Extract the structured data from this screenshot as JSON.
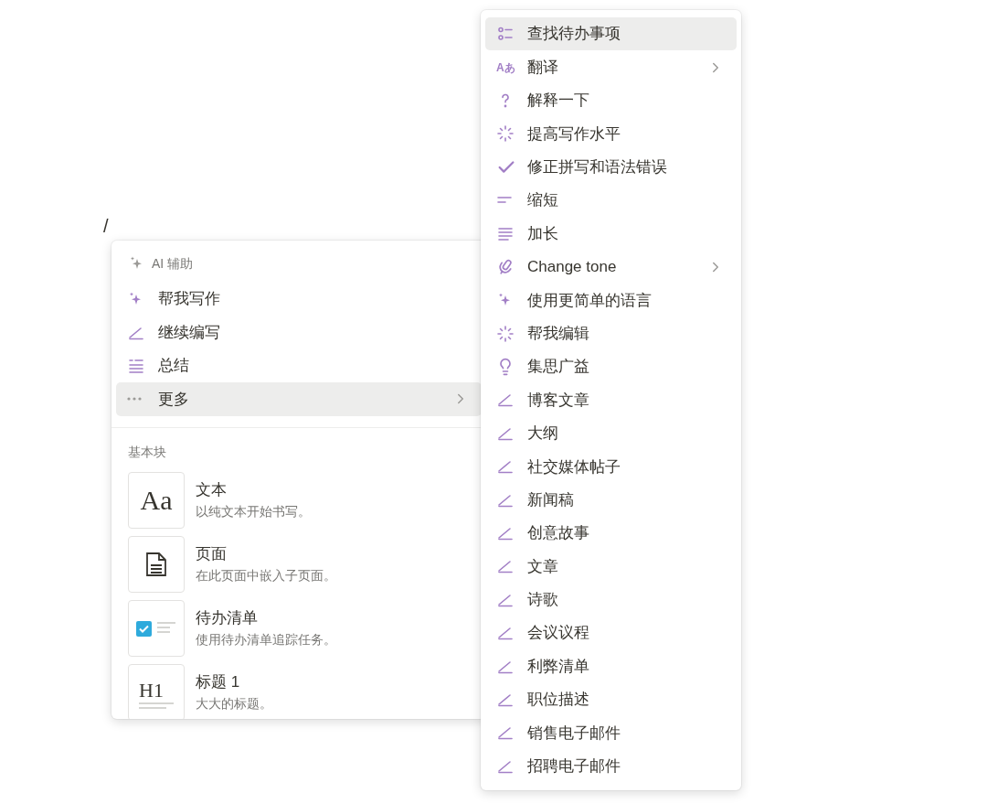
{
  "editor": {
    "slash": "/"
  },
  "block_menu": {
    "ai_section": {
      "title": "AI 辅助",
      "items": [
        {
          "kind": "sparkle",
          "label": "帮我写作",
          "selected": false,
          "submenu": false
        },
        {
          "kind": "pen",
          "label": "继续编写",
          "selected": false,
          "submenu": false
        },
        {
          "kind": "summary",
          "label": "总结",
          "selected": false,
          "submenu": false
        },
        {
          "kind": "dots",
          "label": "更多",
          "selected": true,
          "submenu": true
        }
      ]
    },
    "basic_section": {
      "title": "基本块",
      "items": [
        {
          "kind": "text",
          "icon_text": "Aa",
          "title": "文本",
          "description": "以纯文本开始书写。"
        },
        {
          "kind": "page",
          "title": "页面",
          "description": "在此页面中嵌入子页面。"
        },
        {
          "kind": "todo",
          "title": "待办清单",
          "description": "使用待办清单追踪任务。"
        },
        {
          "kind": "heading",
          "icon_text": "H1",
          "title": "标题 1",
          "description": "大大的标题。"
        }
      ]
    }
  },
  "submenu": {
    "items": [
      {
        "kind": "checklist",
        "label": "查找待办事项",
        "selected": true,
        "submenu": false
      },
      {
        "kind": "translate",
        "icon_text": "Aあ",
        "label": "翻译",
        "selected": false,
        "submenu": true
      },
      {
        "kind": "question",
        "label": "解释一下",
        "selected": false,
        "submenu": false
      },
      {
        "kind": "burst",
        "label": "提高写作水平",
        "selected": false,
        "submenu": false
      },
      {
        "kind": "check",
        "label": "修正拼写和语法错误",
        "selected": false,
        "submenu": false
      },
      {
        "kind": "short",
        "label": "缩短",
        "selected": false,
        "submenu": false
      },
      {
        "kind": "long",
        "label": "加长",
        "selected": false,
        "submenu": false
      },
      {
        "kind": "mic",
        "label": "Change tone",
        "selected": false,
        "submenu": true
      },
      {
        "kind": "sparkle",
        "label": "使用更简单的语言",
        "selected": false,
        "submenu": false
      },
      {
        "kind": "burst",
        "label": "帮我编辑",
        "selected": false,
        "submenu": false
      },
      {
        "kind": "bulb",
        "label": "集思广益",
        "selected": false,
        "submenu": false
      },
      {
        "kind": "pen",
        "label": "博客文章",
        "selected": false,
        "submenu": false
      },
      {
        "kind": "pen",
        "label": "大纲",
        "selected": false,
        "submenu": false
      },
      {
        "kind": "pen",
        "label": "社交媒体帖子",
        "selected": false,
        "submenu": false
      },
      {
        "kind": "pen",
        "label": "新闻稿",
        "selected": false,
        "submenu": false
      },
      {
        "kind": "pen",
        "label": "创意故事",
        "selected": false,
        "submenu": false
      },
      {
        "kind": "pen",
        "label": "文章",
        "selected": false,
        "submenu": false
      },
      {
        "kind": "pen",
        "label": "诗歌",
        "selected": false,
        "submenu": false
      },
      {
        "kind": "pen",
        "label": "会议议程",
        "selected": false,
        "submenu": false
      },
      {
        "kind": "pen",
        "label": "利弊清单",
        "selected": false,
        "submenu": false
      },
      {
        "kind": "pen",
        "label": "职位描述",
        "selected": false,
        "submenu": false
      },
      {
        "kind": "pen",
        "label": "销售电子邮件",
        "selected": false,
        "submenu": false
      },
      {
        "kind": "pen",
        "label": "招聘电子邮件",
        "selected": false,
        "submenu": false
      }
    ]
  }
}
